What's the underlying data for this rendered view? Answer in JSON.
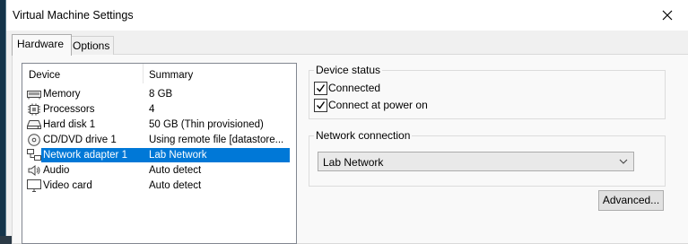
{
  "window": {
    "title": "Virtual Machine Settings"
  },
  "tabs": [
    {
      "label": "Hardware",
      "active": true
    },
    {
      "label": "Options",
      "active": false
    }
  ],
  "device_list": {
    "columns": [
      "Device",
      "Summary"
    ],
    "rows": [
      {
        "device": "Memory",
        "summary": "8 GB",
        "icon": "memory-icon"
      },
      {
        "device": "Processors",
        "summary": "4",
        "icon": "processor-icon"
      },
      {
        "device": "Hard disk 1",
        "summary": "50 GB (Thin provisioned)",
        "icon": "hard-disk-icon"
      },
      {
        "device": "CD/DVD drive 1",
        "summary": "Using remote file [datastore...",
        "icon": "cd-dvd-icon"
      },
      {
        "device": "Network adapter 1",
        "summary": "Lab Network",
        "icon": "network-adapter-icon",
        "selected": true
      },
      {
        "device": "Audio",
        "summary": "Auto detect",
        "icon": "speaker-icon"
      },
      {
        "device": "Video card",
        "summary": "Auto detect",
        "icon": "monitor-icon"
      }
    ]
  },
  "device_status": {
    "title": "Device status",
    "connected": {
      "label": "Connected",
      "checked": true
    },
    "connect_at_power_on": {
      "label": "Connect at power on",
      "checked": true
    }
  },
  "network_connection": {
    "title": "Network connection",
    "selected": "Lab Network"
  },
  "advanced_button": {
    "label": "Advanced..."
  },
  "colors": {
    "selection": "#0078d7",
    "panel": "#f9f9f9",
    "window": "#f0f0f0"
  }
}
